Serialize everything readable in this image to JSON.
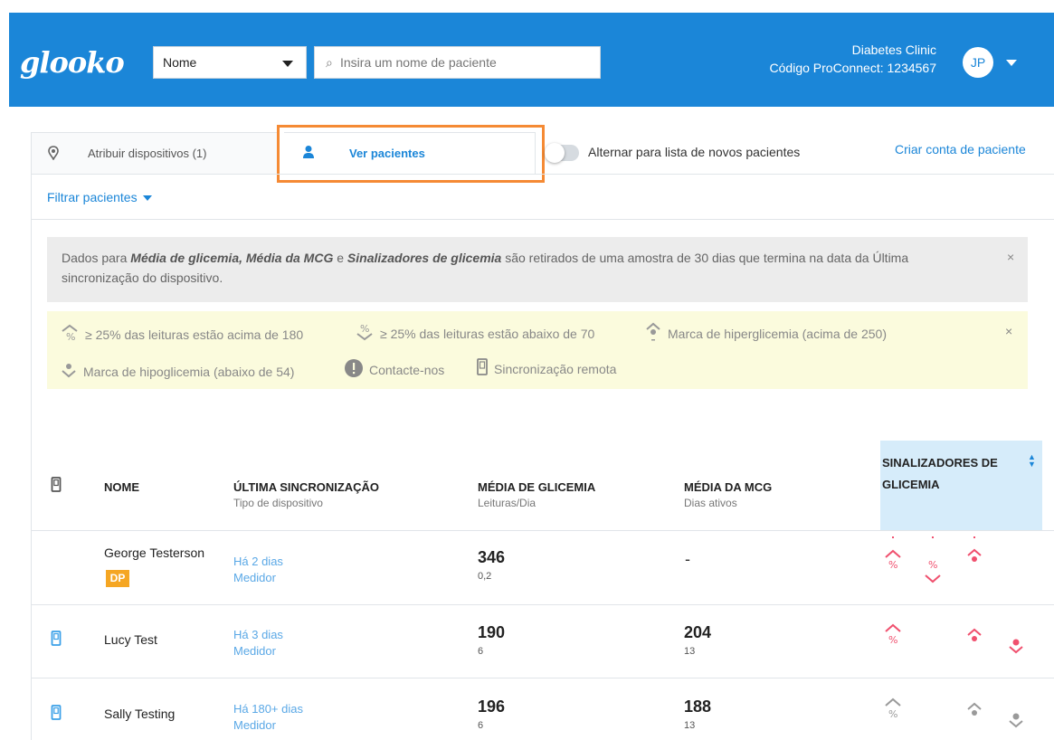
{
  "header": {
    "logo": "glooko",
    "search_type": "Nome",
    "search_placeholder": "Insira um nome de paciente",
    "clinic_name": "Diabetes Clinic",
    "clinic_code": "Código ProConnect: 1234567",
    "avatar_initials": "JP"
  },
  "tabs": {
    "assign_label": "Atribuir dispositivos (1)",
    "view_label": "Ver pacientes"
  },
  "toggle_label": "Alternar para lista de novos pacientes",
  "create_account": "Criar conta de paciente",
  "filter_label": "Filtrar pacientes",
  "info": {
    "prefix": "Dados para ",
    "em1": "Média de glicemia, Média da MCG",
    "mid": " e ",
    "em2": "Sinalizadores de glicemia",
    "suffix": " são retirados de uma amostra de 30 dias que termina na data da Última sincronização do dispositivo.",
    "close": "×"
  },
  "legend": {
    "above": "≥ 25% das leituras estão acima de 180",
    "below": "≥ 25% das leituras estão abaixo de 70",
    "hyper": "Marca de hiperglicemia (acima de 250)",
    "hypo": "Marca de hipoglicemia (abaixo de 54)",
    "contact": "Contacte-nos",
    "remote": "Sincronização remota",
    "close": "×"
  },
  "table": {
    "col_name": "NOME",
    "col_sync": "ÚLTIMA SINCRONIZAÇÃO",
    "col_sync_sub": "Tipo de dispositivo",
    "col_bg": "MÉDIA DE GLICEMIA",
    "col_bg_sub": "Leituras/Dia",
    "col_cgm": "MÉDIA DA MCG",
    "col_cgm_sub": "Dias ativos",
    "col_flags_1": "SINALIZADORES DE",
    "col_flags_2": "GLICEMIA",
    "rows": [
      {
        "name": "George Testerson",
        "badge": "DP",
        "sync": "Há 2 dias",
        "device": "Medidor",
        "bg": "346",
        "bg_sub": "0,2",
        "cgm": "-",
        "cgm_sub": ""
      },
      {
        "name": "Lucy Test",
        "badge": "",
        "sync": "Há 3 dias",
        "device": "Medidor",
        "bg": "190",
        "bg_sub": "6",
        "cgm": "204",
        "cgm_sub": "13"
      },
      {
        "name": "Sally Testing",
        "badge": "",
        "sync": "Há 180+ dias",
        "device": "Medidor",
        "bg": "196",
        "bg_sub": "6",
        "cgm": "188",
        "cgm_sub": "13"
      }
    ]
  },
  "colors": {
    "brand_blue": "#1b86d8",
    "highlight_orange": "#f58a34",
    "flag_red": "#f0506e",
    "flag_gray": "#9a9a9a"
  },
  "icons": [
    "device-icon",
    "user-icon",
    "above-range-icon",
    "below-range-icon",
    "hyper-icon",
    "hypo-icon",
    "contact-icon",
    "remote-sync-icon"
  ]
}
